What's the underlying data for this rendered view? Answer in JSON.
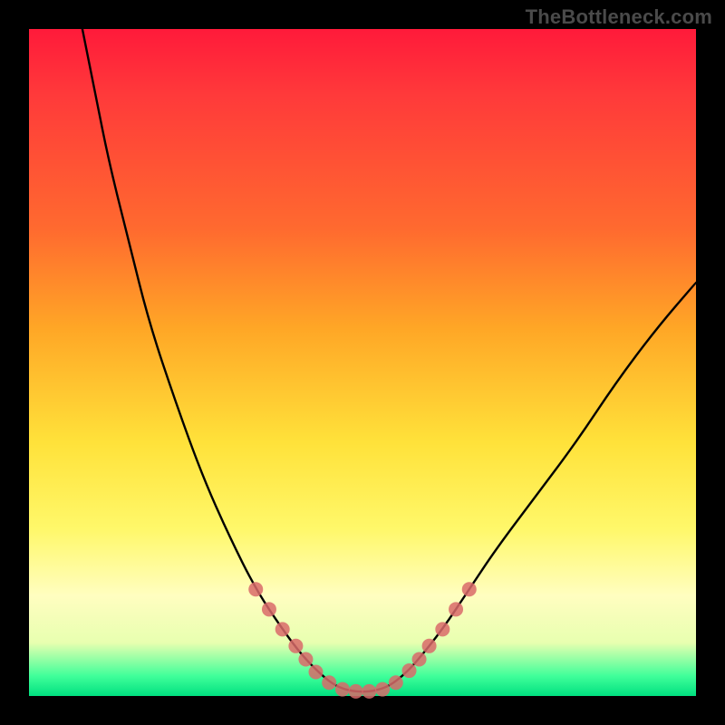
{
  "attribution": "TheBottleneck.com",
  "chart_data": {
    "type": "line",
    "title": "",
    "xlabel": "",
    "ylabel": "",
    "xlim": [
      0,
      100
    ],
    "ylim": [
      0,
      100
    ],
    "grid": false,
    "legend": false,
    "series": [
      {
        "name": "bottleneck-curve",
        "color": "#000000",
        "x": [
          8,
          10,
          12,
          15,
          18,
          22,
          26,
          30,
          34,
          38,
          41,
          44,
          46,
          48,
          50,
          52,
          54,
          56,
          58,
          62,
          66,
          70,
          76,
          82,
          88,
          94,
          100
        ],
        "y": [
          100,
          90,
          80,
          68,
          56,
          44,
          33,
          24,
          16,
          10,
          6,
          3,
          1.5,
          0.8,
          0.6,
          0.8,
          1.5,
          3,
          5,
          10,
          16,
          22,
          30,
          38,
          47,
          55,
          62
        ]
      }
    ],
    "markers": {
      "name": "sample-points",
      "color": "#d96a6a",
      "radius_px": 8,
      "x": [
        34,
        36,
        38,
        40,
        41.5,
        43,
        45,
        47,
        49,
        51,
        53,
        55,
        57,
        58.5,
        60,
        62,
        64,
        66
      ],
      "y": [
        16,
        13,
        10,
        7.5,
        5.5,
        3.6,
        2.0,
        1.0,
        0.7,
        0.7,
        1.0,
        2.0,
        3.8,
        5.5,
        7.5,
        10,
        13,
        16
      ]
    }
  }
}
